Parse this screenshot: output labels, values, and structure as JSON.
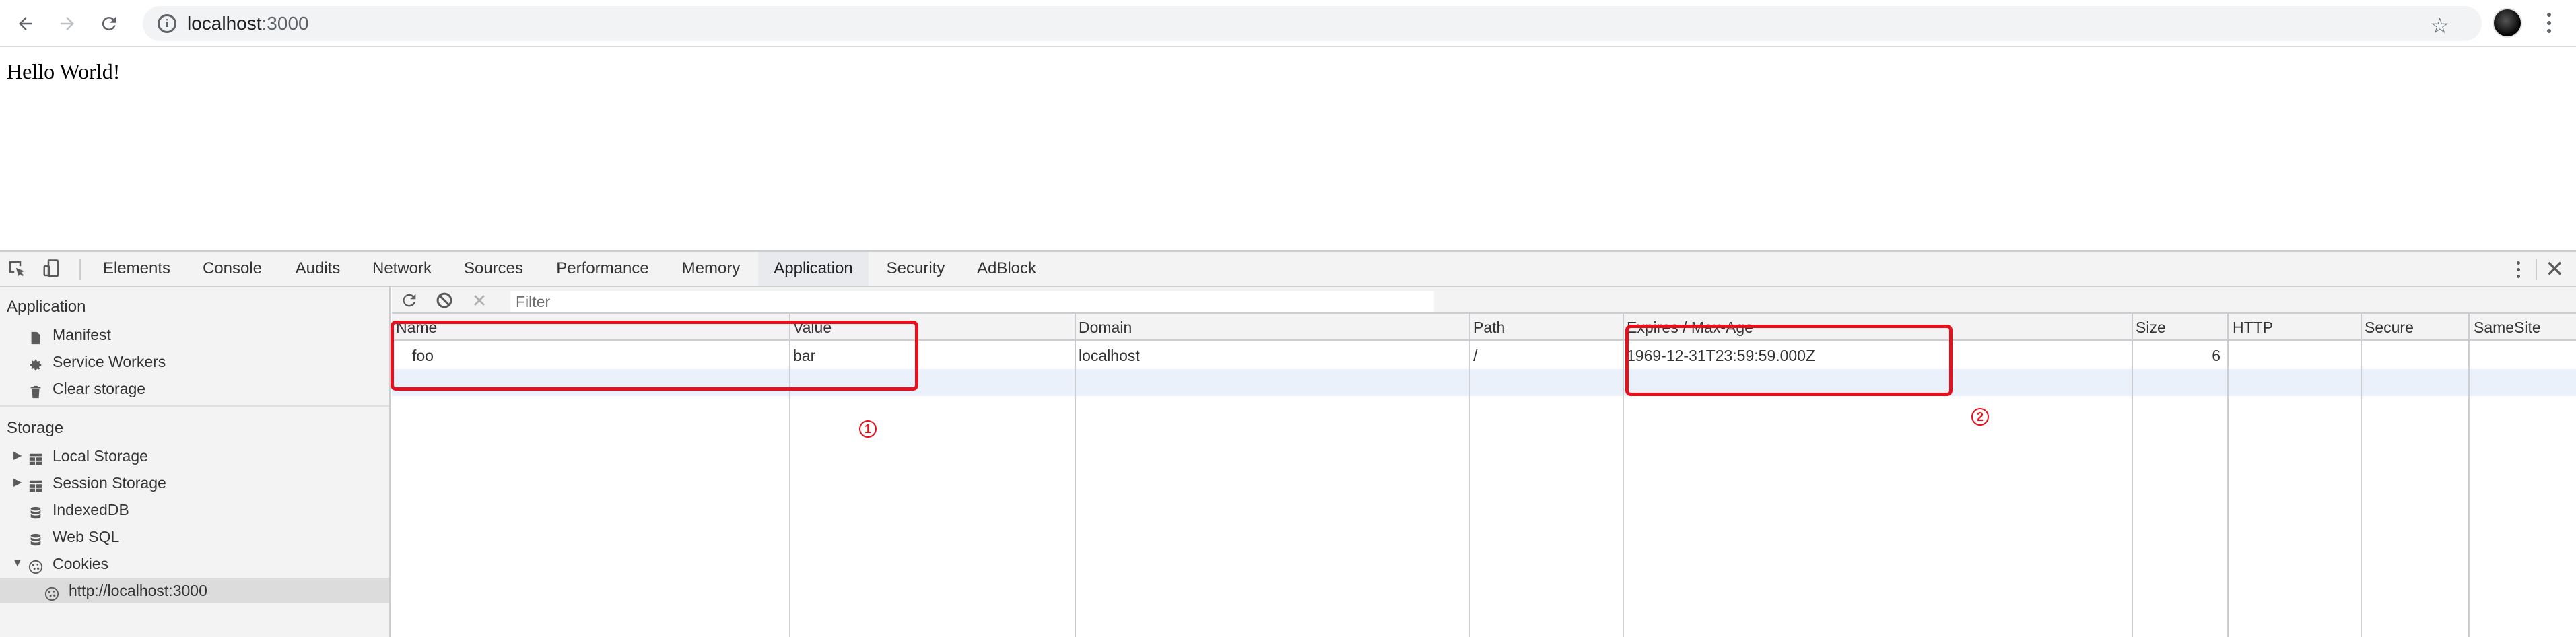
{
  "browser": {
    "url_host": "localhost",
    "url_port": ":3000"
  },
  "page": {
    "text": "Hello World!"
  },
  "devtools": {
    "tabs": [
      "Elements",
      "Console",
      "Audits",
      "Network",
      "Sources",
      "Performance",
      "Memory",
      "Application",
      "Security",
      "AdBlock"
    ],
    "active_tab": "Application"
  },
  "sidebar": {
    "application_header": "Application",
    "application_items": [
      {
        "label": "Manifest",
        "icon": "document-icon"
      },
      {
        "label": "Service Workers",
        "icon": "gear-icon"
      },
      {
        "label": "Clear storage",
        "icon": "trash-icon"
      }
    ],
    "storage_header": "Storage",
    "storage_items": [
      {
        "label": "Local Storage",
        "icon": "grid-icon",
        "expandable": true
      },
      {
        "label": "Session Storage",
        "icon": "grid-icon",
        "expandable": true
      },
      {
        "label": "IndexedDB",
        "icon": "database-icon"
      },
      {
        "label": "Web SQL",
        "icon": "database-icon"
      },
      {
        "label": "Cookies",
        "icon": "cookie-icon",
        "expanded": true
      }
    ],
    "cookie_origin": "http://localhost:3000"
  },
  "cookies": {
    "filter_placeholder": "Filter",
    "columns": [
      "Name",
      "Value",
      "Domain",
      "Path",
      "Expires / Max-Age",
      "Size",
      "HTTP",
      "Secure",
      "SameSite"
    ],
    "rows": [
      {
        "name": "foo",
        "value": "bar",
        "domain": "localhost",
        "path": "/",
        "expires": "1969-12-31T23:59:59.000Z",
        "size": "6",
        "http": "",
        "secure": "",
        "samesite": ""
      }
    ]
  },
  "annotations": {
    "callout_1": "1",
    "callout_2": "2",
    "color": "#e8101c"
  },
  "colors": {
    "accent": "#1a73e8",
    "selected_row": "#eaf1fb"
  }
}
